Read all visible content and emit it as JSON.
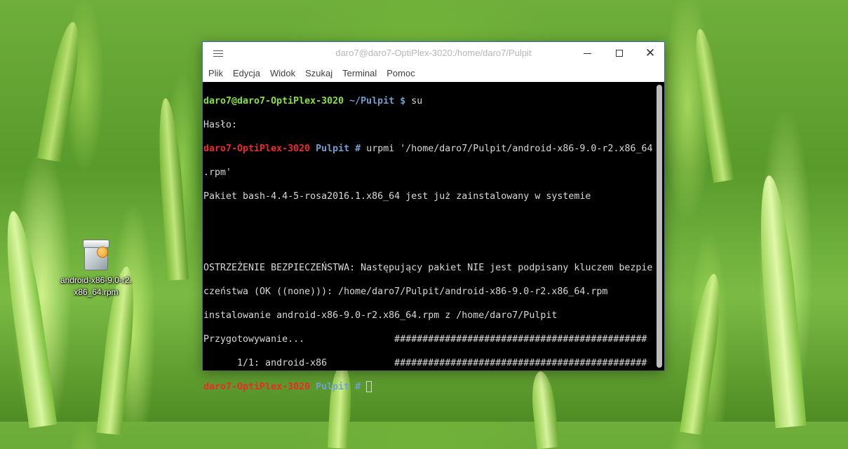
{
  "desktop": {
    "icon_label": "android-x86-9.0-r2.\nx86_64.rpm",
    "icon_name": "package-icon"
  },
  "window": {
    "title": "daro7@daro7-OptiPlex-3020:/home/daro7/Pulpit",
    "controls": [
      "minimize",
      "maximize",
      "close"
    ],
    "accent": "#3b6ea8"
  },
  "menubar": {
    "items": [
      "Plik",
      "Edycja",
      "Widok",
      "Szukaj",
      "Terminal",
      "Pomoc"
    ]
  },
  "terminal": {
    "colors": {
      "background": "#000000",
      "text": "#d8d8d8",
      "user_prompt": "#8ae234",
      "root_prompt": "#ef2929",
      "path": "#729fcf"
    },
    "line1": {
      "userhost": "daro7@daro7-OptiPlex-3020",
      "path": "~/Pulpit",
      "symbol": "$",
      "cmd": " su"
    },
    "line2": "Hasło:",
    "line3": {
      "host": "daro7-OptiPlex-3020",
      "path": "Pulpit",
      "symbol": "#",
      "cmd": " urpmi '/home/daro7/Pulpit/android-x86-9.0-r2.x86_64"
    },
    "line4": ".rpm'",
    "line5": "Pakiet bash-4.4-5-rosa2016.1.x86_64 jest już zainstalowany w systemie",
    "line6": "",
    "line7": "",
    "line8": "OSTRZEŻENIE BEZPIECZEŃSTWA: Następujący pakiet NIE jest podpisany kluczem bezpie",
    "line9": "czeństwa (OK ((none))): /home/daro7/Pulpit/android-x86-9.0-r2.x86_64.rpm",
    "line10": "instalowanie android-x86-9.0-r2.x86_64.rpm z /home/daro7/Pulpit",
    "line11": "Przygotowywanie...                #############################################",
    "line12": "      1/1: android-x86            #############################################",
    "line13": {
      "host": "daro7-OptiPlex-3020",
      "path": "Pulpit",
      "symbol": "#"
    }
  }
}
